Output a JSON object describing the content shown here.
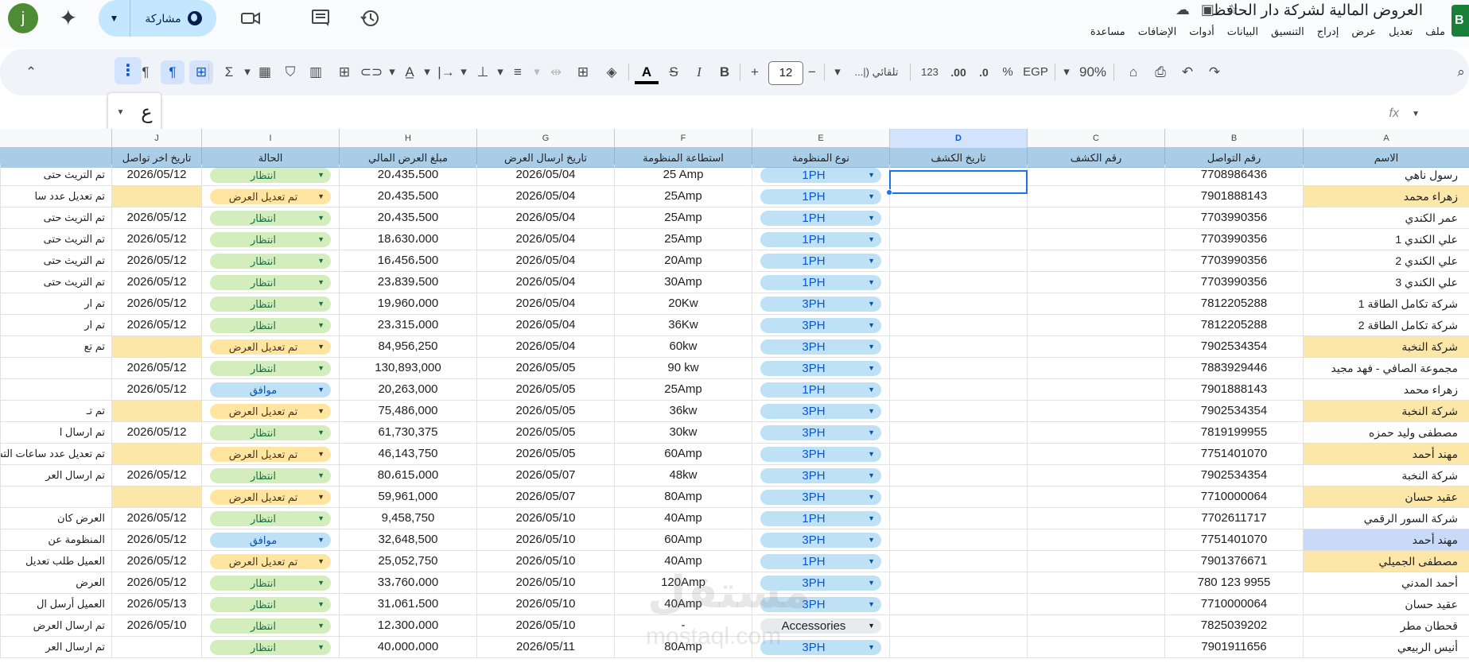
{
  "app": {
    "avatar_letter": "j",
    "share_label": "مشاركة",
    "doc_title": "العروض المالية لشركة دار الحافظ",
    "logo_letter": "B",
    "menu": [
      "ملف",
      "تعديل",
      "عرض",
      "إدراج",
      "التنسيق",
      "البيانات",
      "أدوات",
      "الإضافات",
      "مساعدة"
    ]
  },
  "toolbar": {
    "zoom": "90%",
    "currency": "EGP",
    "percent": "%",
    "dec_decrease": ".0",
    "dec_increase": ".00",
    "number_format": "123",
    "font_name": "تلقائي (|...",
    "font_size": "12",
    "minus": "−",
    "plus": "+"
  },
  "formula_bar": {
    "cell_ref": "ع",
    "fx": "fx"
  },
  "columns": {
    "letters": [
      "A",
      "B",
      "C",
      "D",
      "E",
      "F",
      "G",
      "H",
      "I",
      "J"
    ],
    "headers": [
      "الاسم",
      "رقم التواصل",
      "رقم الكشف",
      "تاريخ الكشف",
      "نوع المنظومة",
      "استطاعة المنظومة",
      "تاريخ ارسال العرض",
      "مبلغ العرض المالي",
      "الحالة",
      "تاريخ اخر تواصل"
    ]
  },
  "rows": [
    {
      "name": "رسول ناهي",
      "phone": "7708986436",
      "type": "1PH",
      "cap": "25 Amp",
      "sent": "2026/05/04",
      "amount": "20،435،500",
      "status": "انتظار",
      "last": "2026/05/12",
      "note": "تم التريث حتى",
      "hl": ""
    },
    {
      "name": "زهراء محمد",
      "phone": "7901888143",
      "type": "1PH",
      "cap": "25Amp",
      "sent": "2026/05/04",
      "amount": "20،435،500",
      "status": "تم تعديل العرض",
      "last": "",
      "note": "تم تعديل عدد سا",
      "hl": "y"
    },
    {
      "name": "عمر الكندي",
      "phone": "7703990356",
      "type": "1PH",
      "cap": "25Amp",
      "sent": "2026/05/04",
      "amount": "20،435،500",
      "status": "انتظار",
      "last": "2026/05/12",
      "note": "تم التريث حتى",
      "hl": ""
    },
    {
      "name": "علي الكندي 1",
      "phone": "7703990356",
      "type": "1PH",
      "cap": "25Amp",
      "sent": "2026/05/04",
      "amount": "18،630،000",
      "status": "انتظار",
      "last": "2026/05/12",
      "note": "تم التريث حتى",
      "hl": ""
    },
    {
      "name": "علي الكندي 2",
      "phone": "7703990356",
      "type": "1PH",
      "cap": "20Amp",
      "sent": "2026/05/04",
      "amount": "16،456،500",
      "status": "انتظار",
      "last": "2026/05/12",
      "note": "تم التريث حتى",
      "hl": ""
    },
    {
      "name": "علي الكندي 3",
      "phone": "7703990356",
      "type": "1PH",
      "cap": "30Amp",
      "sent": "2026/05/04",
      "amount": "23،839،500",
      "status": "انتظار",
      "last": "2026/05/12",
      "note": "تم التريث حتى",
      "hl": ""
    },
    {
      "name": "شركة تكامل الطاقة 1",
      "phone": "7812205288",
      "type": "3PH",
      "cap": "20Kw",
      "sent": "2026/05/04",
      "amount": "19،960،000",
      "status": "انتظار",
      "last": "2026/05/12",
      "note": "تم ار",
      "hl": ""
    },
    {
      "name": "شركة تكامل الطاقة 2",
      "phone": "7812205288",
      "type": "3PH",
      "cap": "36Kw",
      "sent": "2026/05/04",
      "amount": "23،315،000",
      "status": "انتظار",
      "last": "2026/05/12",
      "note": "تم ار",
      "hl": ""
    },
    {
      "name": "شركة النخبة",
      "phone": "7902534354",
      "type": "3PH",
      "cap": "60kw",
      "sent": "2026/05/04",
      "amount": "84,956,250",
      "status": "تم تعديل العرض",
      "last": "",
      "note": "تم تع",
      "hl": "y"
    },
    {
      "name": "مجموعة الصافي - فهد مجيد",
      "phone": "7883929446",
      "type": "3PH",
      "cap": "90 kw",
      "sent": "2026/05/05",
      "amount": "130,893,000",
      "status": "انتظار",
      "last": "2026/05/12",
      "note": "",
      "hl": ""
    },
    {
      "name": "زهراء محمد",
      "phone": "7901888143",
      "type": "1PH",
      "cap": "25Amp",
      "sent": "2026/05/05",
      "amount": "20,263,000",
      "status": "موافق",
      "last": "2026/05/12",
      "note": "",
      "hl": ""
    },
    {
      "name": "شركة النخبة",
      "phone": "7902534354",
      "type": "3PH",
      "cap": "36kw",
      "sent": "2026/05/05",
      "amount": "75,486,000",
      "status": "تم تعديل العرض",
      "last": "",
      "note": "تم تـ",
      "hl": "y"
    },
    {
      "name": "مصطفى وليد حمزه",
      "phone": "7819199955",
      "type": "3PH",
      "cap": "30kw",
      "sent": "2026/05/05",
      "amount": "61,730,375",
      "status": "انتظار",
      "last": "2026/05/12",
      "note": "تم ارسال ا",
      "hl": ""
    },
    {
      "name": "مهند أحمد",
      "phone": "7751401070",
      "type": "3PH",
      "cap": "60Amp",
      "sent": "2026/05/05",
      "amount": "46,143,750",
      "status": "تم تعديل العرض",
      "last": "",
      "note": "تم تعديل عدد ساعات التش",
      "hl": "y"
    },
    {
      "name": "شركة النخبة",
      "phone": "7902534354",
      "type": "3PH",
      "cap": "48kw",
      "sent": "2026/05/07",
      "amount": "80،615،000",
      "status": "انتظار",
      "last": "2026/05/12",
      "note": "تم ارسال العر",
      "hl": ""
    },
    {
      "name": "عقيد حسان",
      "phone": "7710000064",
      "type": "3PH",
      "cap": "80Amp",
      "sent": "2026/05/07",
      "amount": "59,961,000",
      "status": "تم تعديل العرض",
      "last": "",
      "note": "",
      "hl": "y"
    },
    {
      "name": "شركة السور الرقمي",
      "phone": "7702611717",
      "type": "1PH",
      "cap": "40Amp",
      "sent": "2026/05/10",
      "amount": "9,458,750",
      "status": "انتظار",
      "last": "2026/05/12",
      "note": "العرض كان",
      "hl": ""
    },
    {
      "name": "مهند أحمد",
      "phone": "7751401070",
      "type": "3PH",
      "cap": "60Amp",
      "sent": "2026/05/10",
      "amount": "32,648,500",
      "status": "موافق",
      "last": "2026/05/12",
      "note": "المنظومة عن",
      "hl": "b"
    },
    {
      "name": "مصطفى الجميلي",
      "phone": "7901376671",
      "type": "1PH",
      "cap": "40Amp",
      "sent": "2026/05/10",
      "amount": "25,052,750",
      "status": "تم تعديل العرض",
      "last": "2026/05/12",
      "note": "العميل طلب تعديل",
      "hl": "y"
    },
    {
      "name": "أحمد المدني",
      "phone": "780 123 9955",
      "type": "3PH",
      "cap": "120Amp",
      "sent": "2026/05/10",
      "amount": "33،760،000",
      "status": "انتظار",
      "last": "2026/05/12",
      "note": "العرض",
      "hl": ""
    },
    {
      "name": "عقيد حسان",
      "phone": "7710000064",
      "type": "3PH",
      "cap": "40Amp",
      "sent": "2026/05/10",
      "amount": "31،061،500",
      "status": "انتظار",
      "last": "2026/05/13",
      "note": "العميل أرسل ال",
      "hl": ""
    },
    {
      "name": "قحطان مطر",
      "phone": "7825039202",
      "type": "Accessories",
      "cap": "-",
      "sent": "2026/05/10",
      "amount": "12،300،000",
      "status": "انتظار",
      "last": "2026/05/10",
      "note": "تم ارسال العرض",
      "hl": ""
    },
    {
      "name": "أنيس الربيعي",
      "phone": "7901911656",
      "type": "3PH",
      "cap": "80Amp",
      "sent": "2026/05/11",
      "amount": "40،000،000",
      "status": "انتظار",
      "last": "",
      "note": "تم ارسال العر",
      "hl": ""
    }
  ],
  "watermark": {
    "line1": "مستقل",
    "line2": "mostaql.com"
  },
  "colors": {
    "header_fill": "#a9cde6",
    "highlight_yellow": "#fde7a8",
    "highlight_blue": "#c9daf8",
    "chip_wait": "#d4edbc",
    "chip_modified": "#ffe5a0",
    "chip_type": "#bfe1f6",
    "accent": "#0b57d0"
  }
}
